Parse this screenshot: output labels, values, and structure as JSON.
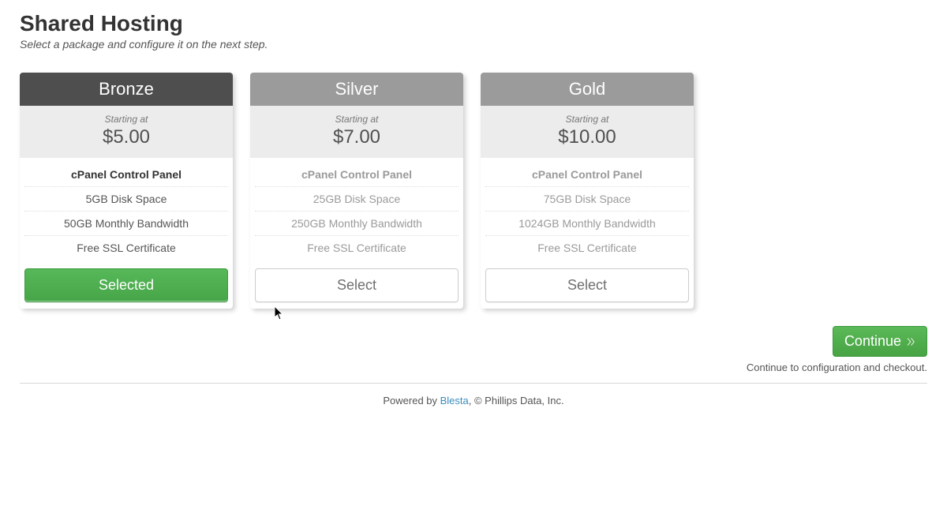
{
  "page": {
    "title": "Shared Hosting",
    "subtitle": "Select a package and configure it on the next step."
  },
  "plans": [
    {
      "name": "Bronze",
      "starting_at": "Starting at",
      "price": "$5.00",
      "features": [
        "cPanel Control Panel",
        "5GB Disk Space",
        "50GB Monthly Bandwidth",
        "Free SSL Certificate"
      ],
      "button": "Selected"
    },
    {
      "name": "Silver",
      "starting_at": "Starting at",
      "price": "$7.00",
      "features": [
        "cPanel Control Panel",
        "25GB Disk Space",
        "250GB Monthly Bandwidth",
        "Free SSL Certificate"
      ],
      "button": "Select"
    },
    {
      "name": "Gold",
      "starting_at": "Starting at",
      "price": "$10.00",
      "features": [
        "cPanel Control Panel",
        "75GB Disk Space",
        "1024GB Monthly Bandwidth",
        "Free SSL Certificate"
      ],
      "button": "Select"
    }
  ],
  "continue": {
    "label": "Continue",
    "hint": "Continue to configuration and checkout."
  },
  "footer": {
    "prefix": "Powered by ",
    "link": "Blesta",
    "suffix": ", © Phillips Data, Inc."
  }
}
